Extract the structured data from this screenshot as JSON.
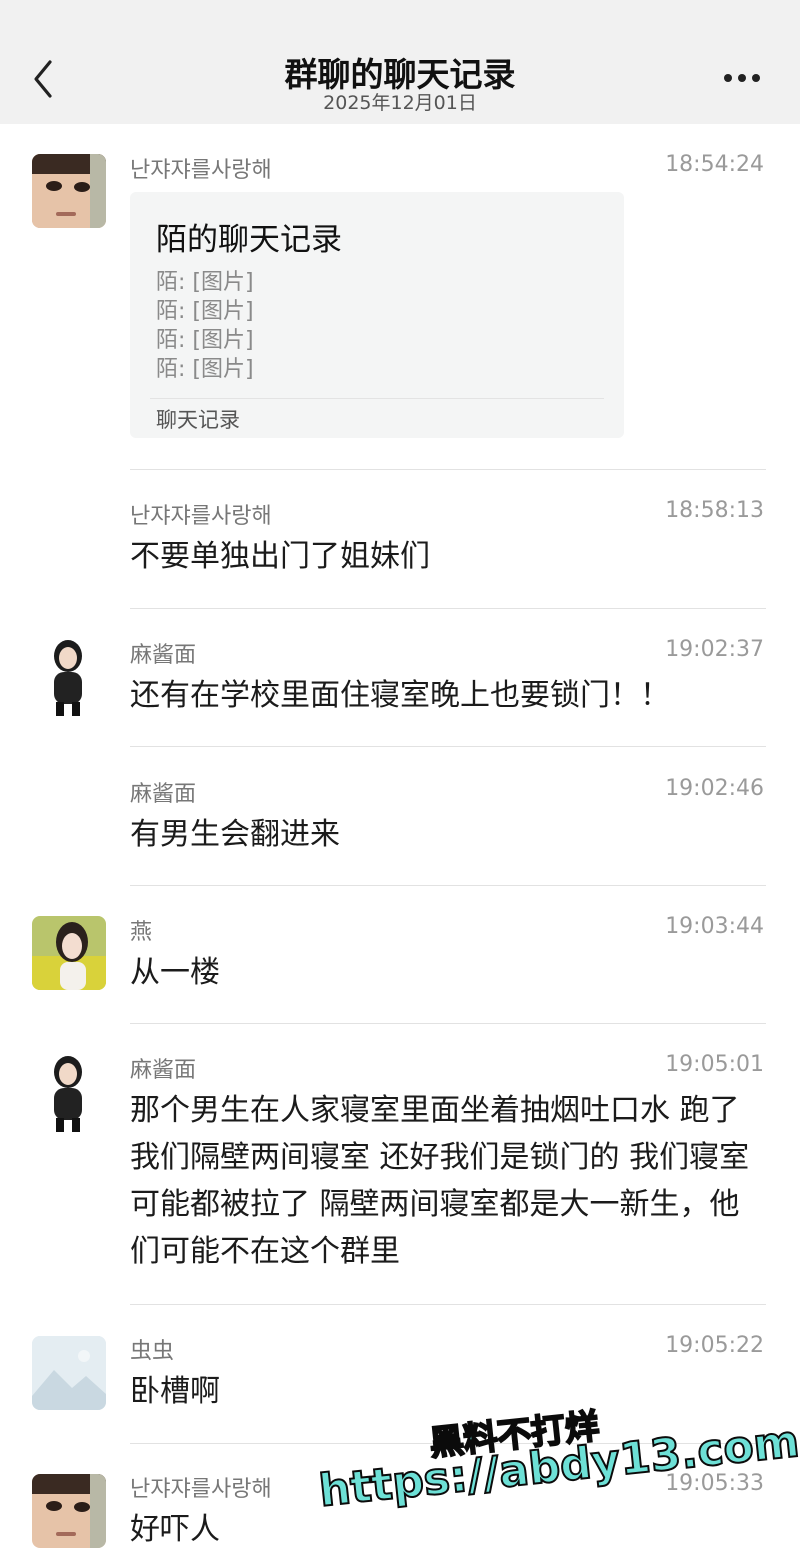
{
  "header": {
    "title": "群聊的聊天记录",
    "date": "2025年12月01日"
  },
  "card": {
    "title": "陌的聊天记录",
    "lines": [
      "陌: [图片]",
      "陌: [图片]",
      "陌: [图片]",
      "陌: [图片]"
    ],
    "footer": "聊天记录"
  },
  "messages": [
    {
      "name": "난쟈쟈를사랑해",
      "time": "18:54:24"
    },
    {
      "name": "난쟈쟈를사랑해",
      "time": "18:58:13",
      "text": "不要单独出门了姐妹们"
    },
    {
      "name": "麻酱面",
      "time": "19:02:37",
      "text": "还有在学校里面住寝室晚上也要锁门！！"
    },
    {
      "name": "麻酱面",
      "time": "19:02:46",
      "text": "有男生会翻进来"
    },
    {
      "name": "燕",
      "time": "19:03:44",
      "text": "从一楼"
    },
    {
      "name": "麻酱面",
      "time": "19:05:01",
      "text": "那个男生在人家寝室里面坐着抽烟吐口水 跑了我们隔壁两间寝室 还好我们是锁门的 我们寝室可能都被拉了 隔壁两间寝室都是大一新生，他们可能不在这个群里"
    },
    {
      "name": "虫虫",
      "time": "19:05:22",
      "text": "卧槽啊"
    },
    {
      "name": "난쟈쟈를사랑해",
      "time": "19:05:33",
      "text": "好吓人"
    }
  ],
  "watermark": {
    "line1": "黑料不打烊",
    "line2": "https://abdy13.com"
  },
  "colors": {
    "header_bg": "#f1f1f1",
    "watermark": "#6de0d6"
  }
}
